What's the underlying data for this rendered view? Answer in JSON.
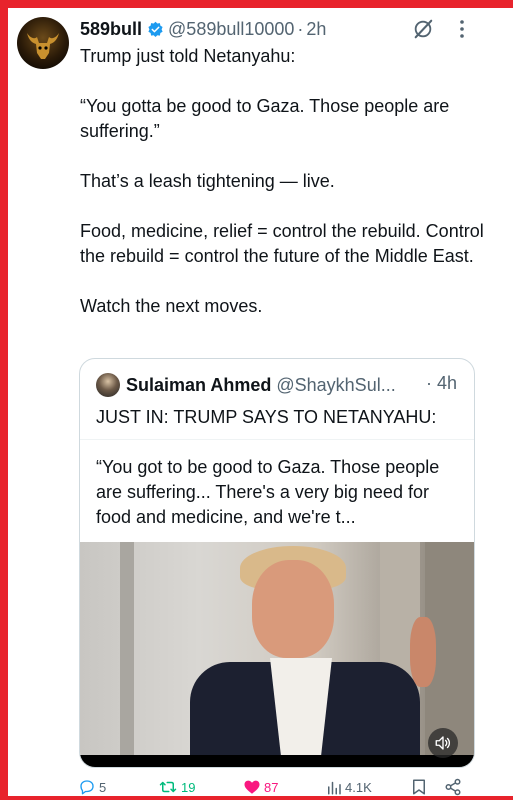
{
  "tweet": {
    "author_name": "589bull",
    "author_handle": "@589bull10000",
    "separator": "·",
    "time": "2h",
    "paragraphs": [
      "Trump just told Netanyahu:",
      "“You gotta be good to Gaza. Those people are suffering.”",
      "That’s a leash tightening — live.",
      "Food, medicine, relief = control the rebuild. Control the rebuild = control the future of the Middle East.",
      "Watch the next moves."
    ]
  },
  "quote": {
    "author_name": "Sulaiman Ahmed",
    "author_handle": "@ShaykhSul...",
    "time": "· 4h",
    "headline": "JUST IN: TRUMP SAYS TO NETANYAHU:",
    "text": "“You got to be good to Gaza. Those people are suffering... There's a very big need for food and medicine, and we're t..."
  },
  "actions": {
    "replies": "5",
    "retweets": "19",
    "likes": "87",
    "views": "4.1K"
  },
  "colors": {
    "frame": "#e8232c",
    "verified": "#1d9bf0",
    "retweet": "#00ba7c",
    "like": "#f91880",
    "secondary_text": "#536471"
  },
  "icons": [
    "verified-badge-icon",
    "grok-icon",
    "more-icon",
    "mute-icon",
    "reply-icon",
    "retweet-icon",
    "heart-icon",
    "views-icon",
    "bookmark-icon",
    "share-icon"
  ]
}
